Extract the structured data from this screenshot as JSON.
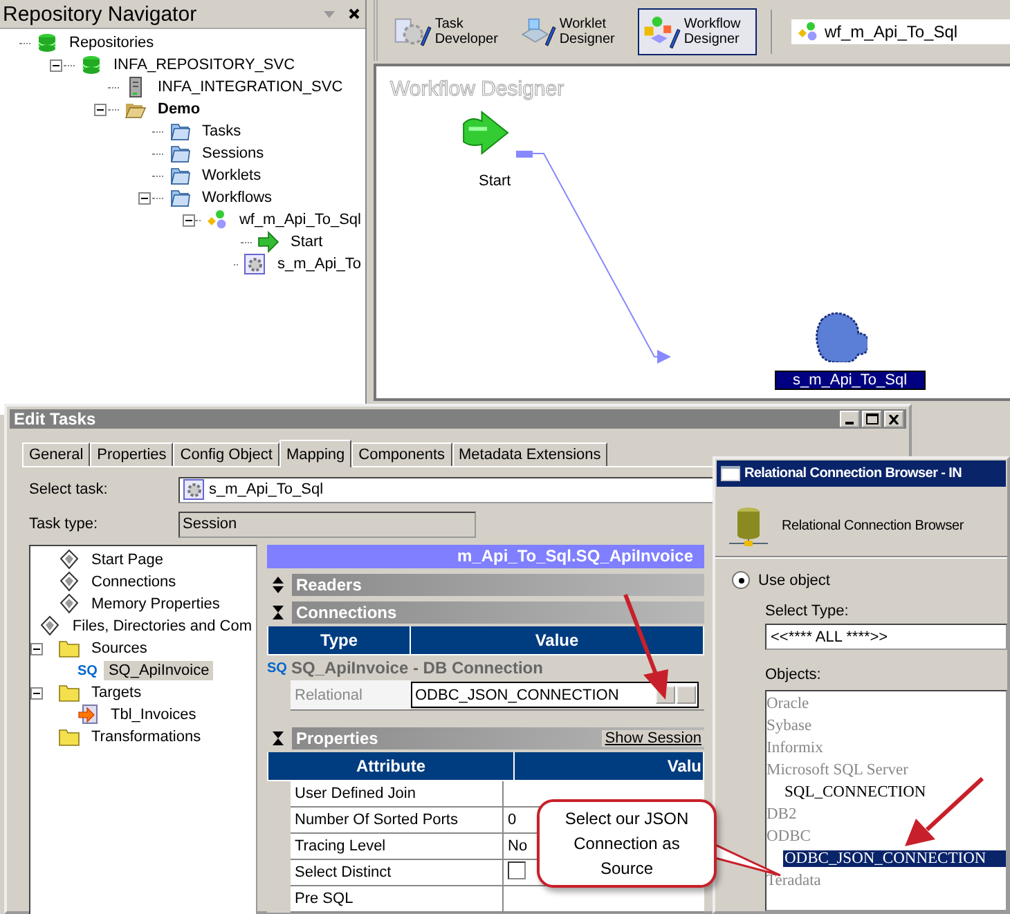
{
  "navigator": {
    "title": "Repository Navigator",
    "tree": [
      {
        "label": "Repositories",
        "kind": "repository",
        "selected": false,
        "children": [
          {
            "label": "INFA_REPOSITORY_SVC",
            "kind": "repository",
            "expanded": true,
            "selected": false,
            "children": [
              {
                "label": "INFA_INTEGRATION_SVC",
                "kind": "server",
                "selected": false
              },
              {
                "label": "Demo",
                "kind": "openfolder",
                "expanded": true,
                "selected": true,
                "children": [
                  {
                    "label": "Tasks",
                    "kind": "folder",
                    "selected": false
                  },
                  {
                    "label": "Sessions",
                    "kind": "folder",
                    "selected": false
                  },
                  {
                    "label": "Worklets",
                    "kind": "folder",
                    "selected": false
                  },
                  {
                    "label": "Workflows",
                    "kind": "folder",
                    "expanded": true,
                    "selected": false,
                    "children": [
                      {
                        "label": "wf_m_Api_To_Sql",
                        "kind": "workflow",
                        "expanded": true,
                        "selected": false,
                        "children": [
                          {
                            "label": "Start",
                            "kind": "start",
                            "selected": false
                          },
                          {
                            "label": "s_m_Api_To",
                            "kind": "session",
                            "selected": false
                          }
                        ]
                      }
                    ]
                  }
                ]
              }
            ]
          }
        ]
      }
    ]
  },
  "designer": {
    "toolbar": [
      {
        "label": "Task Developer",
        "selected": false
      },
      {
        "label": "Worklet Designer",
        "selected": false
      },
      {
        "label": "Workflow Designer",
        "selected": true
      }
    ],
    "workflow_field": "wf_m_Api_To_Sql",
    "canvas_title": "Workflow Designer",
    "nodes": [
      {
        "kind": "start",
        "label": "Start",
        "selected": false
      },
      {
        "kind": "session",
        "label": "s_m_Api_To_Sql",
        "selected": true
      }
    ]
  },
  "edit_tasks": {
    "title": "Edit Tasks",
    "tabs": [
      {
        "label": "General",
        "selected": false
      },
      {
        "label": "Properties",
        "selected": false
      },
      {
        "label": "Config Object",
        "selected": false
      },
      {
        "label": "Mapping",
        "selected": true
      },
      {
        "label": "Components",
        "selected": false
      },
      {
        "label": "Metadata Extensions",
        "selected": false
      }
    ],
    "select_task_label": "Select task:",
    "select_task": "s_m_Api_To_Sql",
    "task_type_label": "Task type:",
    "task_type": "Session",
    "tree": [
      {
        "label": "Start Page",
        "kind": "page",
        "selected": false
      },
      {
        "label": "Connections",
        "kind": "page",
        "selected": false
      },
      {
        "label": "Memory Properties",
        "kind": "page",
        "selected": false
      },
      {
        "label": "Files, Directories and Com",
        "kind": "page",
        "selected": false
      },
      {
        "label": "Sources",
        "kind": "yfolder",
        "expanded": true,
        "selected": false,
        "children": [
          {
            "label": "SQ_ApiInvoice",
            "badge": "SQ",
            "selected": true
          }
        ]
      },
      {
        "label": "Targets",
        "kind": "yfolder",
        "expanded": true,
        "selected": false,
        "children": [
          {
            "label": "Tbl_Invoices",
            "kind": "target",
            "selected": false
          }
        ]
      },
      {
        "label": "Transformations",
        "kind": "yfolder",
        "selected": false
      }
    ],
    "header": "m_Api_To_Sql.SQ_ApiInvoice",
    "sections": [
      {
        "label": "Readers",
        "expanded": false
      },
      {
        "label": "Connections",
        "expanded": true
      }
    ],
    "connections": {
      "columns": [
        "Type",
        "Value"
      ],
      "group": {
        "badge": "SQ",
        "label": "SQ_ApiInvoice - DB Connection"
      },
      "rows": [
        {
          "type": "Relational",
          "value": "ODBC_JSON_CONNECTION"
        }
      ]
    },
    "properties": {
      "label": "Properties",
      "expanded": true,
      "link": "Show Session",
      "columns": [
        "Attribute",
        "Valu"
      ],
      "rows": [
        {
          "kind": "text",
          "attribute": "User Defined Join"
        },
        {
          "kind": "text",
          "attribute": "Number Of Sorted Ports",
          "value": "0"
        },
        {
          "kind": "text",
          "attribute": "Tracing Level",
          "value": "No"
        },
        {
          "kind": "checkbox",
          "attribute": "Select Distinct",
          "checked": false
        },
        {
          "kind": "text",
          "attribute": "Pre SQL"
        }
      ]
    }
  },
  "connection_browser": {
    "title": "Relational Connection Browser - IN",
    "heading": "Relational Connection Browser",
    "use_object": {
      "label": "Use object",
      "selected": true
    },
    "select_type_label": "Select Type:",
    "select_type": "<<**** ALL ****>>",
    "objects_label": "Objects:",
    "objects": [
      {
        "kind": "group",
        "label": "Oracle",
        "selected": false
      },
      {
        "kind": "group",
        "label": "Sybase",
        "selected": false
      },
      {
        "kind": "group",
        "label": "Informix",
        "selected": false
      },
      {
        "kind": "group",
        "label": "Microsoft SQL Server",
        "selected": false
      },
      {
        "kind": "item",
        "label": "SQL_CONNECTION",
        "selected": false
      },
      {
        "kind": "group",
        "label": "DB2",
        "selected": false
      },
      {
        "kind": "group",
        "label": "ODBC",
        "selected": false
      },
      {
        "kind": "item",
        "label": "ODBC_JSON_CONNECTION",
        "selected": true
      },
      {
        "kind": "group",
        "label": "Teradata",
        "selected": false
      }
    ]
  },
  "callout": {
    "text": "Select our JSON Connection as Source"
  }
}
